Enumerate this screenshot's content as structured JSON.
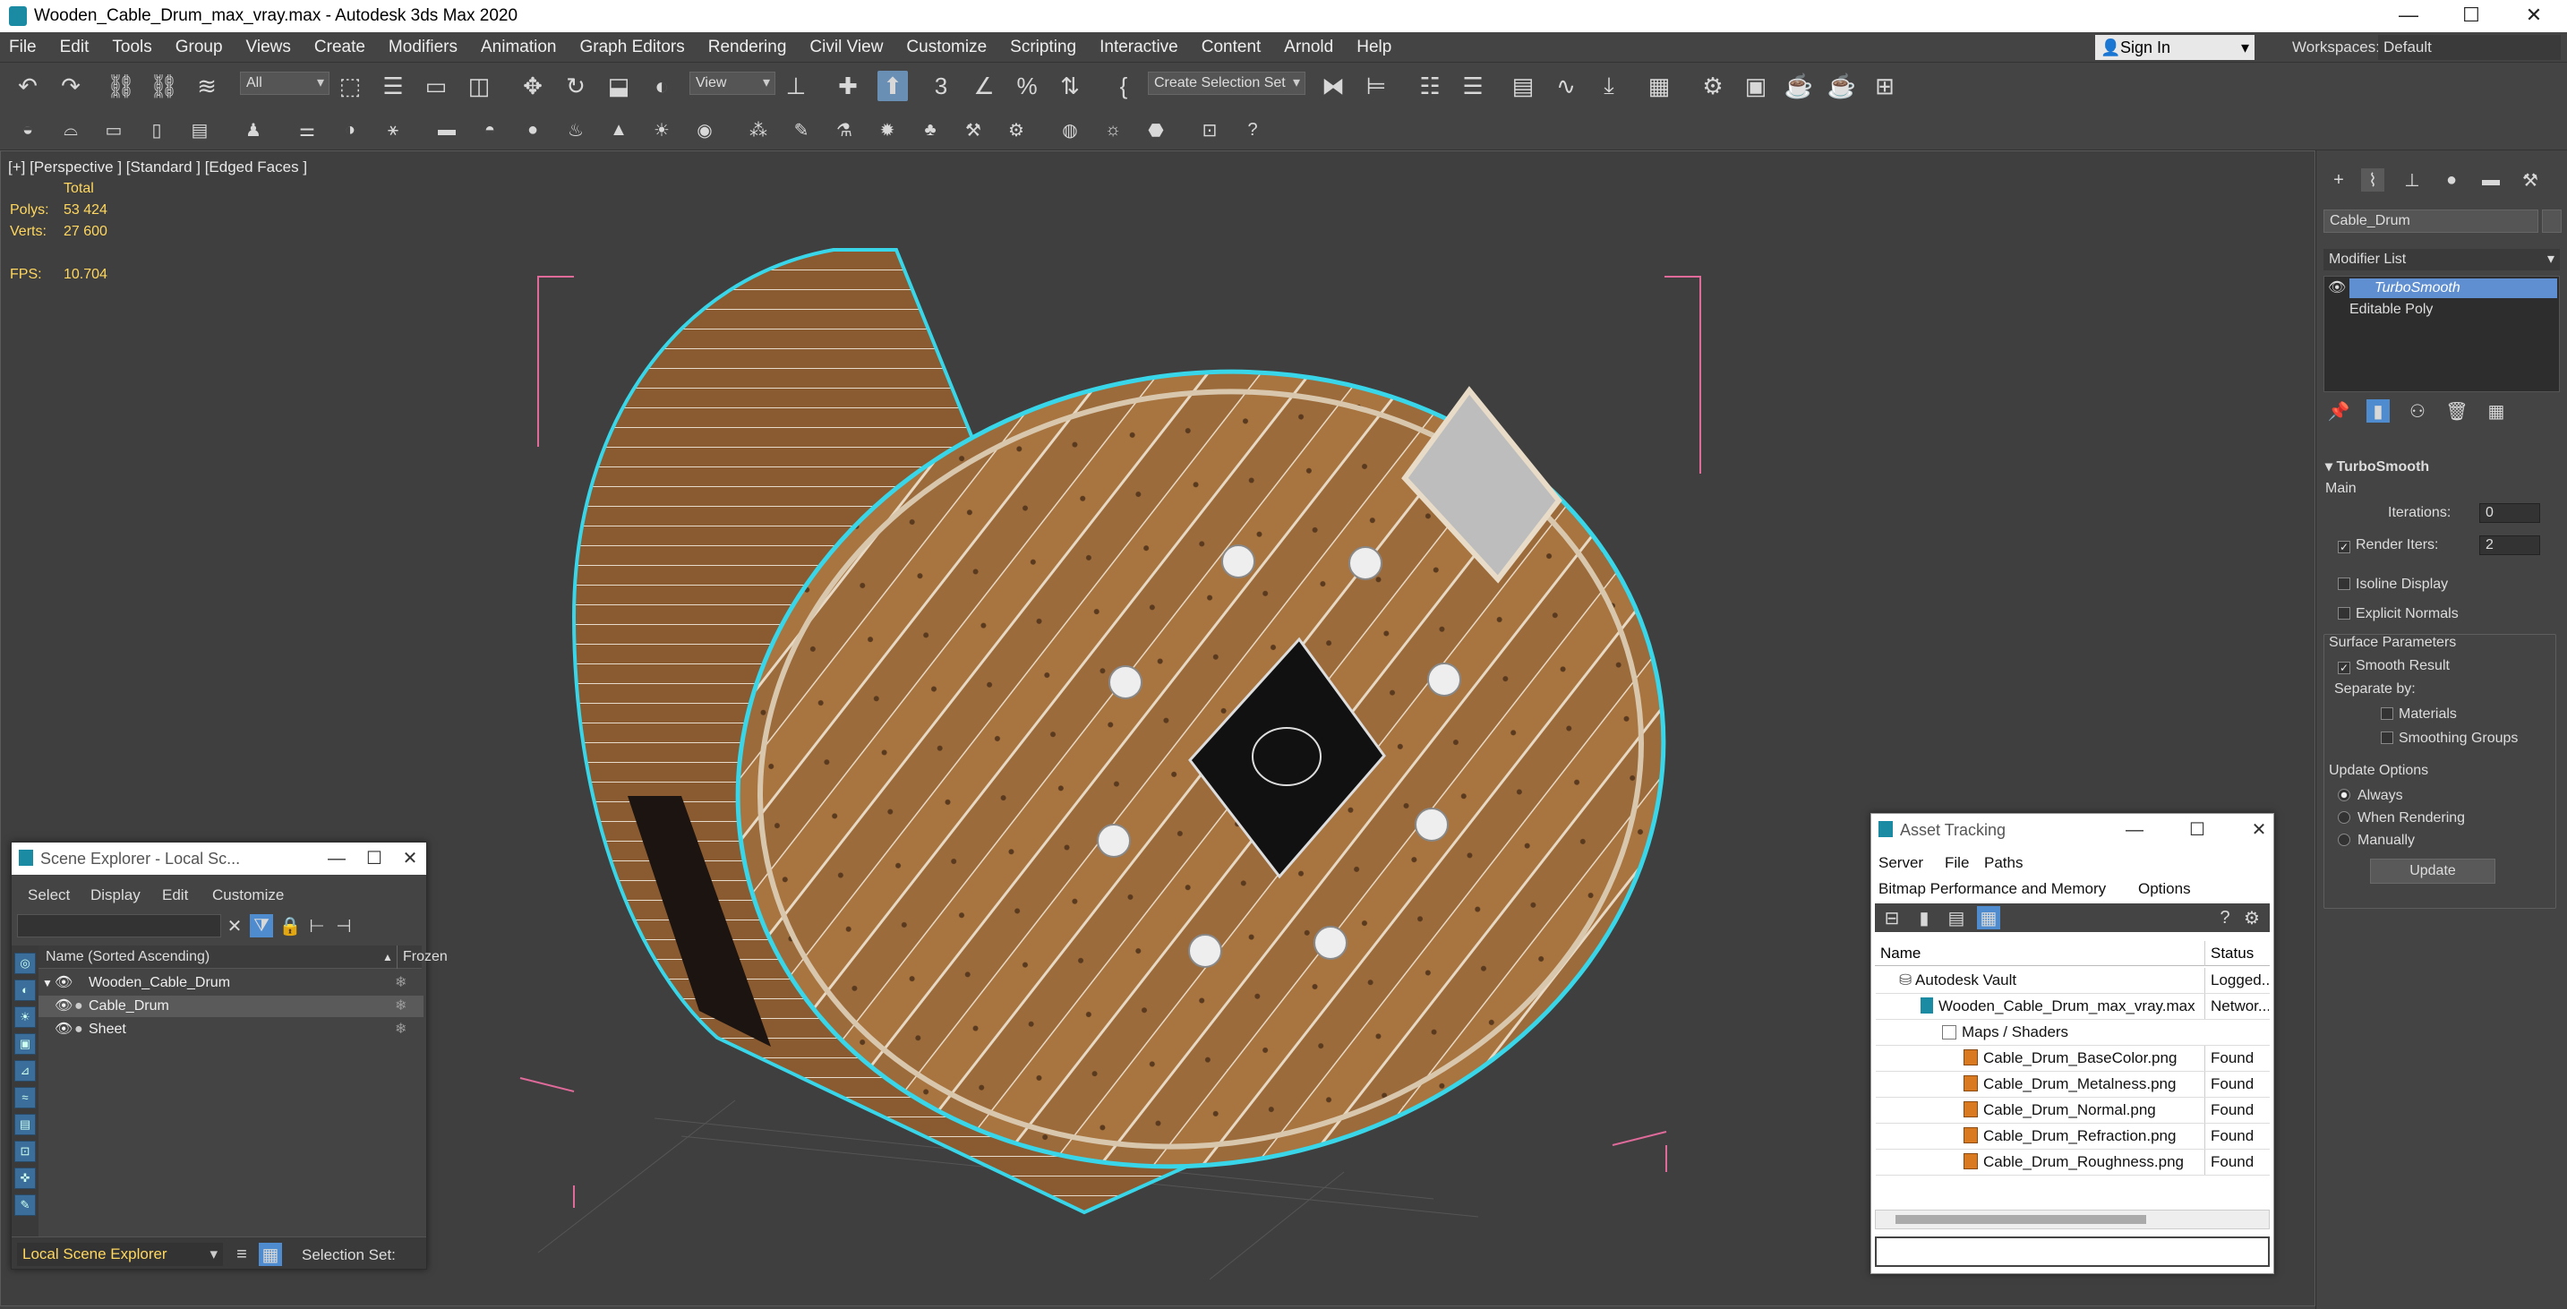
{
  "window": {
    "title": "Wooden_Cable_Drum_max_vray.max - Autodesk 3ds Max 2020",
    "minimize": "—",
    "maximize": "☐",
    "close": "✕"
  },
  "menu": [
    "File",
    "Edit",
    "Tools",
    "Group",
    "Views",
    "Create",
    "Modifiers",
    "Animation",
    "Graph Editors",
    "Rendering",
    "Civil View",
    "Customize",
    "Scripting",
    "Interactive",
    "Content",
    "Arnold",
    "Help"
  ],
  "account": {
    "sign_in": "Sign In",
    "workspaces_label": "Workspaces:",
    "workspace": "Default"
  },
  "toolbar": {
    "filter": "All",
    "view": "View",
    "selection_set": "Create Selection Set"
  },
  "viewport": {
    "label": "[+] [Perspective ] [Standard ] [Edged Faces ]",
    "stats": {
      "total_label": "Total",
      "polys_label": "Polys:",
      "polys": "53 424",
      "verts_label": "Verts:",
      "verts": "27 600",
      "fps_label": "FPS:",
      "fps": "10.704"
    }
  },
  "command_panel": {
    "object_name": "Cable_Drum",
    "modifier_list": "Modifier List",
    "stack": [
      "TurboSmooth",
      "Editable Poly"
    ],
    "rollout": "TurboSmooth",
    "main": "Main",
    "iterations_label": "Iterations:",
    "iterations": "0",
    "render_iters_label": "Render Iters:",
    "render_iters": "2",
    "isoline": "Isoline Display",
    "explicit_normals": "Explicit Normals",
    "surface_params": "Surface Parameters",
    "smooth_result": "Smooth Result",
    "separate_by": "Separate by:",
    "materials": "Materials",
    "smoothing_groups": "Smoothing Groups",
    "update_options": "Update Options",
    "always": "Always",
    "when_rendering": "When Rendering",
    "manually": "Manually",
    "update_button": "Update"
  },
  "scene_explorer": {
    "title": "Scene Explorer - Local Sc...",
    "menu": [
      "Select",
      "Display",
      "Edit",
      "Customize"
    ],
    "col_name": "Name (Sorted Ascending)",
    "col_frozen": "Frozen",
    "items": [
      "Wooden_Cable_Drum",
      "Cable_Drum",
      "Sheet"
    ],
    "footer_mode": "Local Scene Explorer",
    "selection_set_label": "Selection Set:"
  },
  "asset_tracking": {
    "title": "Asset Tracking",
    "menu": [
      "Server",
      "File",
      "Paths"
    ],
    "menu2": [
      "Bitmap Performance and Memory",
      "Options"
    ],
    "col_name": "Name",
    "col_status": "Status",
    "rows": [
      {
        "name": "Autodesk Vault",
        "status": "Logged..."
      },
      {
        "name": "Wooden_Cable_Drum_max_vray.max",
        "status": "Networ..."
      },
      {
        "name": "Maps / Shaders",
        "status": ""
      },
      {
        "name": "Cable_Drum_BaseColor.png",
        "status": "Found"
      },
      {
        "name": "Cable_Drum_Metalness.png",
        "status": "Found"
      },
      {
        "name": "Cable_Drum_Normal.png",
        "status": "Found"
      },
      {
        "name": "Cable_Drum_Refraction.png",
        "status": "Found"
      },
      {
        "name": "Cable_Drum_Roughness.png",
        "status": "Found"
      }
    ]
  },
  "colors": {
    "accent": "#4e8ccf",
    "selection_outline": "#37d4e6",
    "wood": "#9a6a3e",
    "stat_text": "#ffd75e"
  }
}
